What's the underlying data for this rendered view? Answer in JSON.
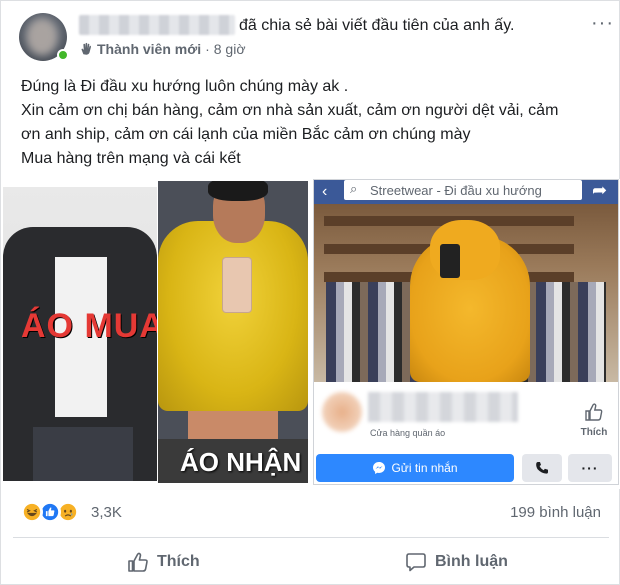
{
  "post": {
    "author_action": "đã chia sẻ bài viết đầu tiên của anh ấy.",
    "badge": "Thành viên mới",
    "separator": "·",
    "time": "8 giờ",
    "more_icon": "ellipsis-icon",
    "body_lines": [
      "Đúng là Đi đầu xu hướng luôn chúng mày ak .",
      "Xin cảm ơn chị bán hàng, cảm ơn nhà sản xuất, cảm ơn người dệt vải, cảm",
      "ơn anh ship, cảm ơn cái lạnh của miền Bắc cảm ơn chúng mày",
      "Mua hàng trên mạng và cái kết"
    ]
  },
  "gallery": {
    "image1_label": "ÁO MUA",
    "image2_label": "ÁO NHẬN",
    "shop": {
      "search_text": "Streetwear - Đi đầu xu hướng",
      "category": "Cửa hàng quần áo",
      "like_label": "Thích",
      "message_button": "Gửi tin nhắn"
    }
  },
  "reactions": {
    "count": "3,3K",
    "types": [
      "haha",
      "like",
      "sad"
    ],
    "colors": {
      "haha": "#f7b125",
      "like": "#2078f4",
      "sad": "#f7b125"
    }
  },
  "comments": {
    "count_label": "199 bình luận"
  },
  "actions": {
    "like_label": "Thích",
    "comment_label": "Bình luận"
  },
  "colors": {
    "brand": "#3b5998",
    "messenger": "#2d88ff",
    "text_secondary": "#606770"
  }
}
